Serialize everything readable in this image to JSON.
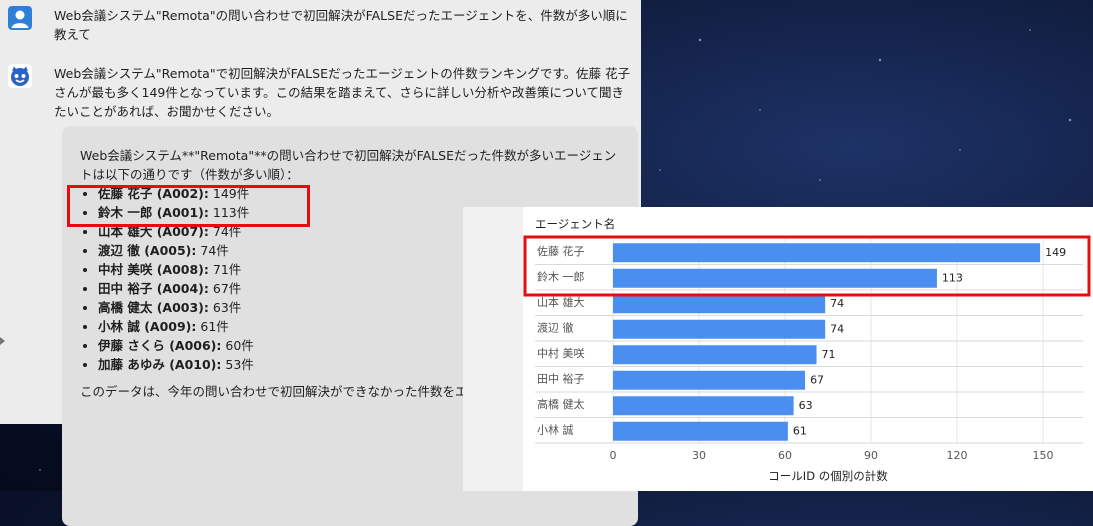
{
  "user_message": {
    "avatar_icon": "user-avatar-icon",
    "text": "Web会議システム\"Remota\"の問い合わせで初回解決がFALSEだったエージェントを、件数が多い順に教えて"
  },
  "bot_message": {
    "avatar_icon": "bot-avatar-icon",
    "summary": "Web会議システム\"Remota\"で初回解決がFALSEだったエージェントの件数ランキングです。佐藤 花子さんが最も多く149件となっています。この結果を踏まえて、さらに詳しい分析や改善策について聞きたいことがあれば、お聞かせください。",
    "answer_intro": "Web会議システム**\"Remota\"**の問い合わせで初回解決がFALSEだった件数が多いエージェントは以下の通りです（件数が多い順）：",
    "ranking": [
      {
        "name": "佐藤 花子 (A002):",
        "count": " 149件"
      },
      {
        "name": "鈴木 一郎 (A001):",
        "count": " 113件"
      },
      {
        "name": "山本 雄大 (A007):",
        "count": " 74件"
      },
      {
        "name": "渡辺 徹 (A005):",
        "count": " 74件"
      },
      {
        "name": "中村 美咲 (A008):",
        "count": " 71件"
      },
      {
        "name": "田中 裕子 (A004):",
        "count": " 67件"
      },
      {
        "name": "高橋 健太 (A003):",
        "count": " 63件"
      },
      {
        "name": "小林 誠 (A009):",
        "count": " 61件"
      },
      {
        "name": "伊藤 さくら (A006):",
        "count": " 60件"
      },
      {
        "name": "加藤 あゆみ (A010):",
        "count": " 53件"
      }
    ],
    "answer_footer": "このデータは、今年の問い合わせで初回解決ができなかった件数をエージェン"
  },
  "colors": {
    "bar": "#4a8fef",
    "highlight": "#e10f0f"
  },
  "chart_data": {
    "type": "bar",
    "orientation": "horizontal",
    "category_header": "エージェント名",
    "categories": [
      "佐藤 花子",
      "鈴木 一郎",
      "山本 雄大",
      "渡辺 徹",
      "中村 美咲",
      "田中 裕子",
      "高橋 健太",
      "小林 誠"
    ],
    "values": [
      149,
      113,
      74,
      74,
      71,
      67,
      63,
      61
    ],
    "xlabel": "コールID の個別の計数",
    "xticks": [
      0,
      30,
      60,
      90,
      120,
      150
    ],
    "xlim": [
      0,
      150
    ],
    "grid": true,
    "data_labels": true
  }
}
